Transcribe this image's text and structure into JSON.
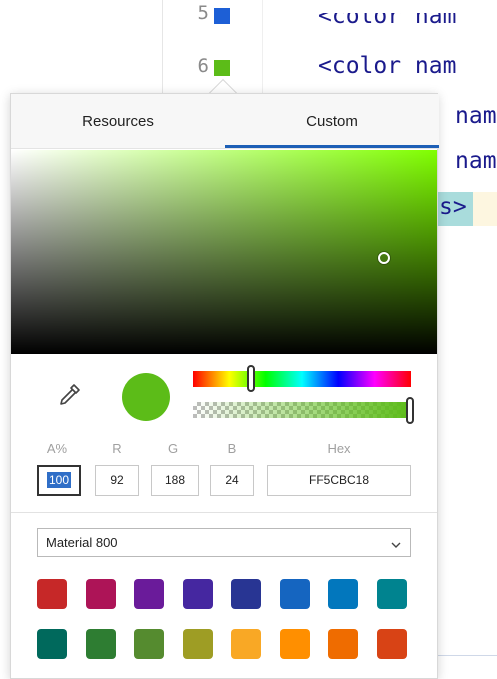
{
  "editor": {
    "line_5": "5",
    "line_6": "6",
    "code_line_1": "<color nam",
    "code_line_2": "<color nam",
    "code_line_3": "nam",
    "code_line_4": "nam",
    "code_line_5": "s>",
    "gutter_swatch_5_color": "#1d5fd6",
    "gutter_swatch_6_color": "#5cbc18"
  },
  "tabs": {
    "resources": "Resources",
    "custom": "Custom",
    "active": "Custom"
  },
  "color": {
    "current_hex": "#5cbc18",
    "hue_position": 0.25,
    "alpha_position": 1.0
  },
  "fields": {
    "alpha_label": "A%",
    "r_label": "R",
    "g_label": "G",
    "b_label": "B",
    "hex_label": "Hex",
    "alpha_value": "100",
    "r_value": "92",
    "g_value": "188",
    "b_value": "24",
    "hex_value": "FF5CBC18"
  },
  "palette": {
    "selected": "Material 800",
    "row1": [
      "#c62828",
      "#ad1457",
      "#6a1b9a",
      "#4527a0",
      "#283593",
      "#1565c0",
      "#0277bd",
      "#00838f"
    ],
    "row2": [
      "#00695c",
      "#2e7d32",
      "#558b2f",
      "#9e9d24",
      "#f9a825",
      "#ff8f00",
      "#ef6c00",
      "#d84315"
    ]
  }
}
